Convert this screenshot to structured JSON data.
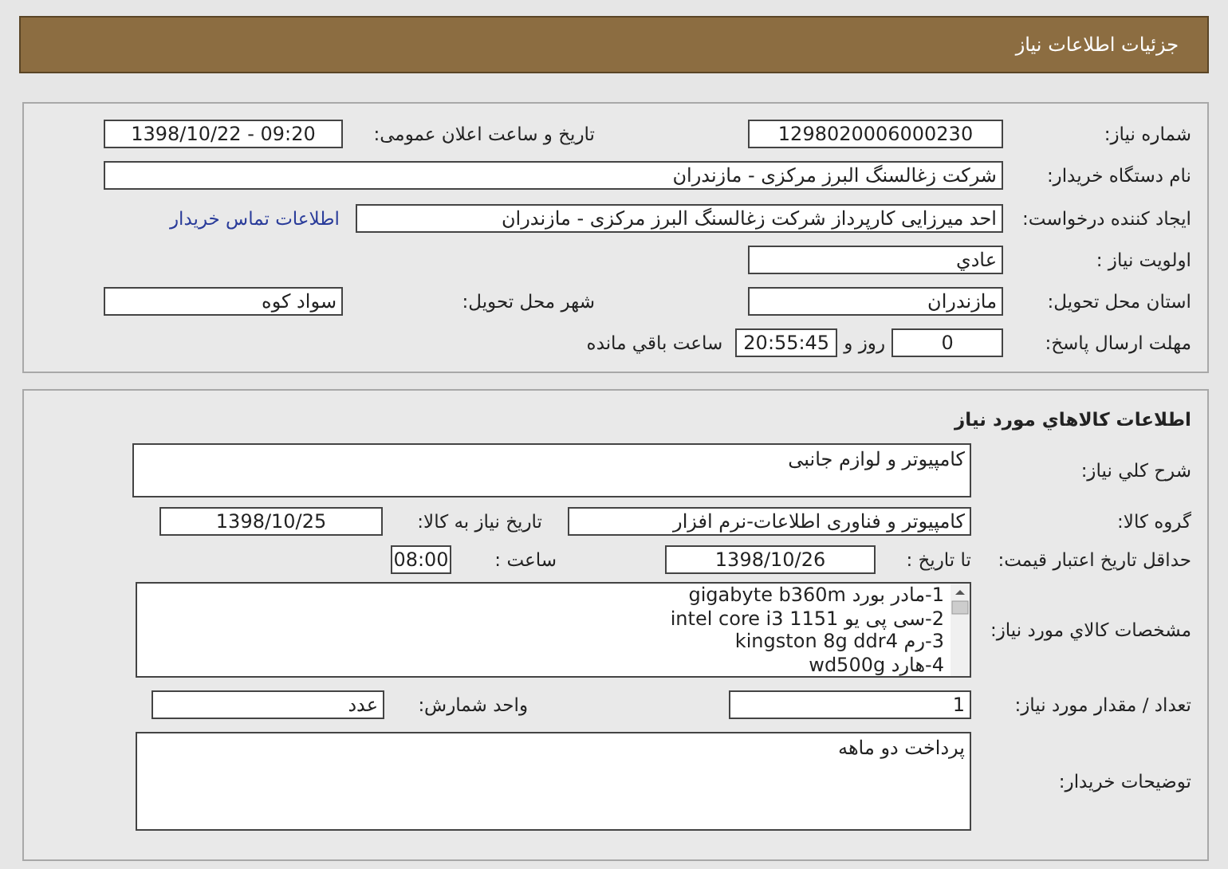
{
  "header": {
    "title": "جزئیات اطلاعات نیاز"
  },
  "need": {
    "need_number": {
      "label": "شماره نیاز:",
      "value": "1298020006000230"
    },
    "announce": {
      "label": "تاریخ و ساعت اعلان عمومی:",
      "value": "1398/10/22 - 09:20"
    },
    "buyer": {
      "label": "نام دستگاه خریدار:",
      "value": "شرکت زغالسنگ البرز مرکزی - مازندران"
    },
    "creator": {
      "label": "ایجاد کننده درخواست:",
      "value": "احد میرزایی کارپرداز شرکت زغالسنگ البرز مرکزی - مازندران"
    },
    "contact_link": "اطلاعات تماس خریدار",
    "priority": {
      "label": "اولویت نیاز :",
      "value": "عادي"
    },
    "province": {
      "label": "استان محل تحویل:",
      "value": "مازندران"
    },
    "city": {
      "label": "شهر محل تحویل:",
      "value": "سواد کوه"
    },
    "deadline": {
      "label": "مهلت ارسال پاسخ:",
      "days": "0",
      "days_unit": "روز و",
      "time": "20:55:45",
      "remaining": "ساعت باقي مانده"
    }
  },
  "goods": {
    "title": "اطلاعات کالاهاي مورد نياز",
    "summary": {
      "label": "شرح کلي نیاز:",
      "value": "کامپیوتر و لوازم جانبی"
    },
    "group": {
      "label": "گروه کالا:",
      "value": "کامپیوتر و فناوری اطلاعات-نرم افزار"
    },
    "need_date": {
      "label": "تاریخ نیاز به کالا:",
      "value": "1398/10/25"
    },
    "validity": {
      "label": "حداقل تاریخ اعتبار قیمت:",
      "to_label": "تا تاریخ :",
      "date": "1398/10/26",
      "time_label": "ساعت :",
      "time": "08:00"
    },
    "specs": {
      "label": "مشخصات کالاي مورد نیاز:",
      "items": [
        "1-مادر بورد gigabyte b360m",
        "2-سی پی یو intel core i3 1151",
        "3-رم kingston 8g ddr4",
        "4-هارد wd500g"
      ]
    },
    "quantity": {
      "label": "تعداد / مقدار مورد نیاز:",
      "value": "1"
    },
    "unit": {
      "label": "واحد شمارش:",
      "value": "عدد"
    },
    "notes": {
      "label": "توضیحات خریدار:",
      "value": "پرداخت دو ماهه"
    }
  }
}
